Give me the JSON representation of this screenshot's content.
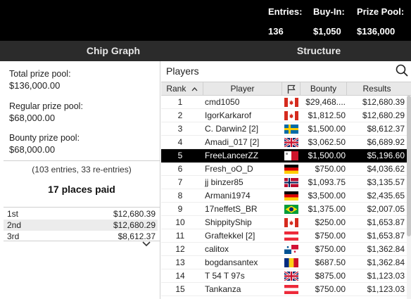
{
  "header": {
    "entries_label": "Entries:",
    "entries_value": "136",
    "buyin_label": "Buy-In:",
    "buyin_value": "$1,050",
    "prize_label": "Prize Pool:",
    "prize_value": "$136,000"
  },
  "tabs": [
    {
      "label": "Chip Graph"
    },
    {
      "label": "Structure"
    }
  ],
  "prize_info": {
    "total_label": "Total prize pool:",
    "total_value": "$136,000.00",
    "regular_label": "Regular prize pool:",
    "regular_value": "$68,000.00",
    "bounty_label": "Bounty prize pool:",
    "bounty_value": "$68,000.00",
    "entries_note": "(103 entries, 33 re-entries)",
    "places_paid": "17 places paid"
  },
  "payouts": [
    {
      "place": "1st",
      "amount": "$12,680.39"
    },
    {
      "place": "2nd",
      "amount": "$12,680.29"
    },
    {
      "place": "3rd",
      "amount": "$8,612.37"
    }
  ],
  "players": {
    "title": "Players",
    "columns": {
      "rank": "Rank",
      "player": "Player",
      "bounty": "Bounty",
      "results": "Results"
    },
    "highlight_color": "#000000",
    "rows": [
      {
        "rank": "1",
        "name": "cmd1050",
        "flag": "canada",
        "bounty": "$29,468....",
        "results": "$12,680.39"
      },
      {
        "rank": "2",
        "name": "IgorKarkarof",
        "flag": "canada",
        "bounty": "$1,812.50",
        "results": "$12,680.29"
      },
      {
        "rank": "3",
        "name": "C. Darwin2 [2]",
        "flag": "sweden",
        "bounty": "$1,500.00",
        "results": "$8,612.37"
      },
      {
        "rank": "4",
        "name": "Amadi_017 [2]",
        "flag": "uk",
        "bounty": "$3,062.50",
        "results": "$6,689.92"
      },
      {
        "rank": "5",
        "name": "FreeLancerZZ",
        "flag": "malta",
        "bounty": "$1,500.00",
        "results": "$5,196.60",
        "highlighted": true
      },
      {
        "rank": "6",
        "name": "Fresh_oO_D",
        "flag": "germany",
        "bounty": "$750.00",
        "results": "$4,036.62"
      },
      {
        "rank": "7",
        "name": "jj binzer85",
        "flag": "norway",
        "bounty": "$1,093.75",
        "results": "$3,135.57"
      },
      {
        "rank": "8",
        "name": "Armani1974",
        "flag": "germany",
        "bounty": "$3,500.00",
        "results": "$2,435.65"
      },
      {
        "rank": "9",
        "name": "17neffetS_BR",
        "flag": "brazil",
        "bounty": "$1,375.00",
        "results": "$2,007.05"
      },
      {
        "rank": "10",
        "name": "ShippityShip",
        "flag": "canada",
        "bounty": "$250.00",
        "results": "$1,653.87"
      },
      {
        "rank": "11",
        "name": "Graftekkel [2]",
        "flag": "austria",
        "bounty": "$750.00",
        "results": "$1,653.87"
      },
      {
        "rank": "12",
        "name": "calitox",
        "flag": "panama",
        "bounty": "$750.00",
        "results": "$1,362.84"
      },
      {
        "rank": "13",
        "name": "bogdansantex",
        "flag": "romania",
        "bounty": "$687.50",
        "results": "$1,362.84"
      },
      {
        "rank": "14",
        "name": "T 54 T 97s",
        "flag": "uk",
        "bounty": "$875.00",
        "results": "$1,123.03"
      },
      {
        "rank": "15",
        "name": "Tankanza",
        "flag": "austria",
        "bounty": "$750.00",
        "results": "$1,123.03"
      }
    ]
  }
}
